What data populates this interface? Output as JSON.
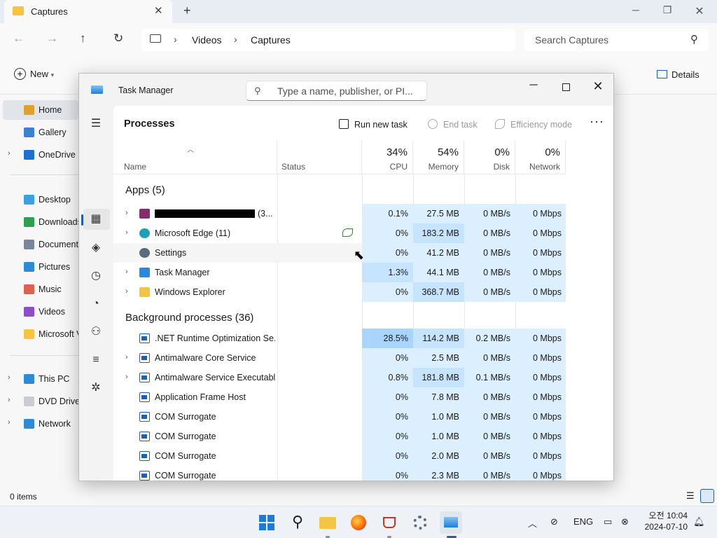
{
  "explorer": {
    "tab_title": "Captures",
    "breadcrumb": [
      "Videos",
      "Captures"
    ],
    "search_placeholder": "Search Captures",
    "new_label": "New",
    "details_label": "Details",
    "status": "0 items",
    "nav": [
      {
        "label": "Home",
        "icon": "home-icon",
        "color": "#e0a030",
        "selected": true
      },
      {
        "label": "Gallery",
        "icon": "gallery-icon",
        "color": "#3a82d0"
      },
      {
        "label": "OneDrive",
        "icon": "cloud-icon",
        "color": "#1f6fd0",
        "expandable": true
      },
      {
        "label": "Desktop",
        "icon": "desktop-icon",
        "color": "#3aa0e0"
      },
      {
        "label": "Downloads",
        "icon": "download-icon",
        "color": "#2e9e4f"
      },
      {
        "label": "Documents",
        "icon": "document-icon",
        "color": "#7a8699"
      },
      {
        "label": "Pictures",
        "icon": "pictures-icon",
        "color": "#2f8ad6"
      },
      {
        "label": "Music",
        "icon": "music-icon",
        "color": "#e0604f"
      },
      {
        "label": "Videos",
        "icon": "videos-icon",
        "color": "#8a4fc8"
      },
      {
        "label": "Microsoft V",
        "icon": "folder-icon",
        "color": "#f5c542"
      },
      {
        "label": "This PC",
        "icon": "pc-icon",
        "color": "#2f8ad6",
        "expandable": true
      },
      {
        "label": "DVD Drive",
        "icon": "dvd-icon",
        "color": "#c9ccd1",
        "expandable": true
      },
      {
        "label": "Network",
        "icon": "network-icon",
        "color": "#2f8ad6",
        "expandable": true
      }
    ]
  },
  "taskmanager": {
    "title": "Task Manager",
    "search_placeholder": "Type a name, publisher, or PI...",
    "page_title": "Processes",
    "actions": {
      "run": "Run new task",
      "end": "End task",
      "efficiency": "Efficiency mode"
    },
    "columns": {
      "name": "Name",
      "status": "Status",
      "cpu": {
        "pct": "34%",
        "label": "CPU"
      },
      "memory": {
        "pct": "54%",
        "label": "Memory"
      },
      "disk": {
        "pct": "0%",
        "label": "Disk"
      },
      "network": {
        "pct": "0%",
        "label": "Network"
      }
    },
    "groups": [
      {
        "label": "Apps (5)",
        "rows": [
          {
            "name": "",
            "redacted": true,
            "suffix": "(3...",
            "expandable": true,
            "icon": "app-icon",
            "icon_color": "#8a2a6e",
            "cpu": "0.1%",
            "mem": "27.5 MB",
            "disk": "0 MB/s",
            "net": "0 Mbps",
            "heat": [
              "h1",
              "h1",
              "h1",
              "h1"
            ]
          },
          {
            "name": "Microsoft Edge (11)",
            "expandable": true,
            "icon": "edge-icon",
            "icon_color": "#1ba1b8",
            "status_icon": true,
            "cpu": "0%",
            "mem": "183.2 MB",
            "disk": "0 MB/s",
            "net": "0 Mbps",
            "heat": [
              "h1",
              "h2",
              "h1",
              "h1"
            ]
          },
          {
            "name": "Settings",
            "expandable": false,
            "icon": "settings-icon",
            "icon_color": "#5b6b7a",
            "hover": true,
            "cpu": "0%",
            "mem": "41.2 MB",
            "disk": "0 MB/s",
            "net": "0 Mbps",
            "heat": [
              "h1",
              "h1",
              "h1",
              "h1"
            ]
          },
          {
            "name": "Task Manager",
            "expandable": true,
            "icon": "taskmanager-icon",
            "icon_color": "#2a88da",
            "cpu": "1.3%",
            "mem": "44.1 MB",
            "disk": "0 MB/s",
            "net": "0 Mbps",
            "heat": [
              "h2",
              "h1",
              "h1",
              "h1"
            ]
          },
          {
            "name": "Windows Explorer",
            "expandable": true,
            "icon": "folder-icon",
            "icon_color": "#f5c542",
            "cpu": "0%",
            "mem": "368.7 MB",
            "disk": "0 MB/s",
            "net": "0 Mbps",
            "heat": [
              "h1",
              "h2",
              "h1",
              "h1"
            ]
          }
        ]
      },
      {
        "label": "Background processes (36)",
        "rows": [
          {
            "name": ".NET Runtime Optimization Se...",
            "expandable": false,
            "icon": "process-icon",
            "cpu": "28.5%",
            "mem": "114.2 MB",
            "disk": "0.2 MB/s",
            "net": "0 Mbps",
            "heat": [
              "h3",
              "h2",
              "h1",
              "h1"
            ]
          },
          {
            "name": "Antimalware Core Service",
            "expandable": true,
            "icon": "process-icon",
            "cpu": "0%",
            "mem": "2.5 MB",
            "disk": "0 MB/s",
            "net": "0 Mbps",
            "heat": [
              "h1",
              "h1",
              "h1",
              "h1"
            ]
          },
          {
            "name": "Antimalware Service Executable",
            "expandable": true,
            "icon": "process-icon",
            "cpu": "0.8%",
            "mem": "181.8 MB",
            "disk": "0.1 MB/s",
            "net": "0 Mbps",
            "heat": [
              "h1",
              "h2",
              "h1",
              "h1"
            ]
          },
          {
            "name": "Application Frame Host",
            "expandable": false,
            "icon": "process-icon",
            "cpu": "0%",
            "mem": "7.8 MB",
            "disk": "0 MB/s",
            "net": "0 Mbps",
            "heat": [
              "h1",
              "h1",
              "h1",
              "h1"
            ]
          },
          {
            "name": "COM Surrogate",
            "expandable": false,
            "icon": "process-icon",
            "cpu": "0%",
            "mem": "1.0 MB",
            "disk": "0 MB/s",
            "net": "0 Mbps",
            "heat": [
              "h1",
              "h1",
              "h1",
              "h1"
            ]
          },
          {
            "name": "COM Surrogate",
            "expandable": false,
            "icon": "process-icon",
            "cpu": "0%",
            "mem": "1.0 MB",
            "disk": "0 MB/s",
            "net": "0 Mbps",
            "heat": [
              "h1",
              "h1",
              "h1",
              "h1"
            ]
          },
          {
            "name": "COM Surrogate",
            "expandable": false,
            "icon": "process-icon",
            "cpu": "0%",
            "mem": "2.0 MB",
            "disk": "0 MB/s",
            "net": "0 Mbps",
            "heat": [
              "h1",
              "h1",
              "h1",
              "h1"
            ]
          },
          {
            "name": "COM Surrogate",
            "expandable": false,
            "icon": "process-icon",
            "cpu": "0%",
            "mem": "2.3 MB",
            "disk": "0 MB/s",
            "net": "0 Mbps",
            "heat": [
              "h1",
              "h1",
              "h1",
              "h1"
            ]
          }
        ]
      }
    ],
    "sidebar_icons": [
      "hamburger-icon",
      "processes-icon",
      "performance-icon",
      "app-history-icon",
      "startup-apps-icon",
      "users-icon",
      "details-icon",
      "services-icon",
      "settings-icon"
    ]
  },
  "taskbar": {
    "apps": [
      "start-icon",
      "search-icon",
      "file-explorer-icon",
      "firefox-icon",
      "java-icon",
      "settings-icon",
      "task-manager-icon"
    ],
    "language": "ENG",
    "time": "오전 10:04",
    "date": "2024-07-10"
  }
}
